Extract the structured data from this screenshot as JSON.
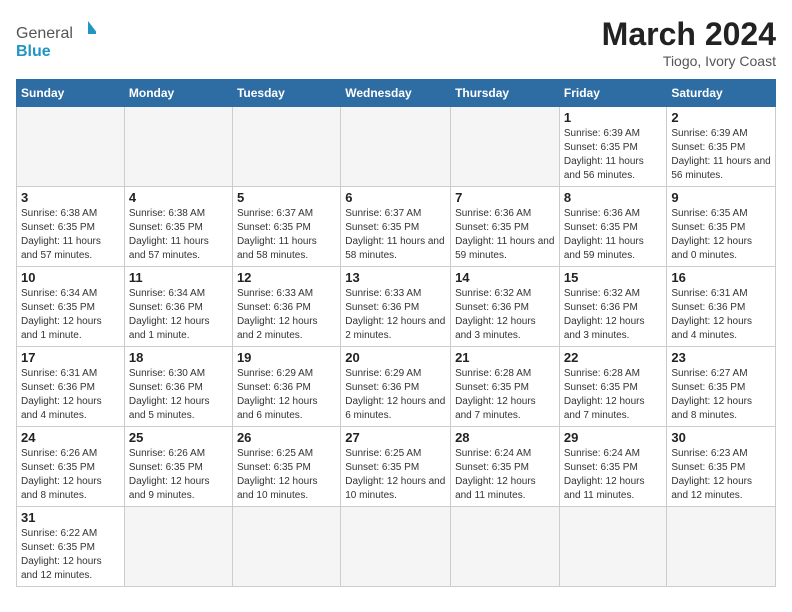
{
  "header": {
    "title": "March 2024",
    "subtitle": "Tiogo, Ivory Coast",
    "logo_general": "General",
    "logo_blue": "Blue"
  },
  "days_of_week": [
    "Sunday",
    "Monday",
    "Tuesday",
    "Wednesday",
    "Thursday",
    "Friday",
    "Saturday"
  ],
  "weeks": [
    [
      {
        "day": "",
        "info": ""
      },
      {
        "day": "",
        "info": ""
      },
      {
        "day": "",
        "info": ""
      },
      {
        "day": "",
        "info": ""
      },
      {
        "day": "",
        "info": ""
      },
      {
        "day": "1",
        "info": "Sunrise: 6:39 AM\nSunset: 6:35 PM\nDaylight: 11 hours and 56 minutes."
      },
      {
        "day": "2",
        "info": "Sunrise: 6:39 AM\nSunset: 6:35 PM\nDaylight: 11 hours and 56 minutes."
      }
    ],
    [
      {
        "day": "3",
        "info": "Sunrise: 6:38 AM\nSunset: 6:35 PM\nDaylight: 11 hours and 57 minutes."
      },
      {
        "day": "4",
        "info": "Sunrise: 6:38 AM\nSunset: 6:35 PM\nDaylight: 11 hours and 57 minutes."
      },
      {
        "day": "5",
        "info": "Sunrise: 6:37 AM\nSunset: 6:35 PM\nDaylight: 11 hours and 58 minutes."
      },
      {
        "day": "6",
        "info": "Sunrise: 6:37 AM\nSunset: 6:35 PM\nDaylight: 11 hours and 58 minutes."
      },
      {
        "day": "7",
        "info": "Sunrise: 6:36 AM\nSunset: 6:35 PM\nDaylight: 11 hours and 59 minutes."
      },
      {
        "day": "8",
        "info": "Sunrise: 6:36 AM\nSunset: 6:35 PM\nDaylight: 11 hours and 59 minutes."
      },
      {
        "day": "9",
        "info": "Sunrise: 6:35 AM\nSunset: 6:35 PM\nDaylight: 12 hours and 0 minutes."
      }
    ],
    [
      {
        "day": "10",
        "info": "Sunrise: 6:34 AM\nSunset: 6:35 PM\nDaylight: 12 hours and 1 minute."
      },
      {
        "day": "11",
        "info": "Sunrise: 6:34 AM\nSunset: 6:36 PM\nDaylight: 12 hours and 1 minute."
      },
      {
        "day": "12",
        "info": "Sunrise: 6:33 AM\nSunset: 6:36 PM\nDaylight: 12 hours and 2 minutes."
      },
      {
        "day": "13",
        "info": "Sunrise: 6:33 AM\nSunset: 6:36 PM\nDaylight: 12 hours and 2 minutes."
      },
      {
        "day": "14",
        "info": "Sunrise: 6:32 AM\nSunset: 6:36 PM\nDaylight: 12 hours and 3 minutes."
      },
      {
        "day": "15",
        "info": "Sunrise: 6:32 AM\nSunset: 6:36 PM\nDaylight: 12 hours and 3 minutes."
      },
      {
        "day": "16",
        "info": "Sunrise: 6:31 AM\nSunset: 6:36 PM\nDaylight: 12 hours and 4 minutes."
      }
    ],
    [
      {
        "day": "17",
        "info": "Sunrise: 6:31 AM\nSunset: 6:36 PM\nDaylight: 12 hours and 4 minutes."
      },
      {
        "day": "18",
        "info": "Sunrise: 6:30 AM\nSunset: 6:36 PM\nDaylight: 12 hours and 5 minutes."
      },
      {
        "day": "19",
        "info": "Sunrise: 6:29 AM\nSunset: 6:36 PM\nDaylight: 12 hours and 6 minutes."
      },
      {
        "day": "20",
        "info": "Sunrise: 6:29 AM\nSunset: 6:36 PM\nDaylight: 12 hours and 6 minutes."
      },
      {
        "day": "21",
        "info": "Sunrise: 6:28 AM\nSunset: 6:35 PM\nDaylight: 12 hours and 7 minutes."
      },
      {
        "day": "22",
        "info": "Sunrise: 6:28 AM\nSunset: 6:35 PM\nDaylight: 12 hours and 7 minutes."
      },
      {
        "day": "23",
        "info": "Sunrise: 6:27 AM\nSunset: 6:35 PM\nDaylight: 12 hours and 8 minutes."
      }
    ],
    [
      {
        "day": "24",
        "info": "Sunrise: 6:26 AM\nSunset: 6:35 PM\nDaylight: 12 hours and 8 minutes."
      },
      {
        "day": "25",
        "info": "Sunrise: 6:26 AM\nSunset: 6:35 PM\nDaylight: 12 hours and 9 minutes."
      },
      {
        "day": "26",
        "info": "Sunrise: 6:25 AM\nSunset: 6:35 PM\nDaylight: 12 hours and 10 minutes."
      },
      {
        "day": "27",
        "info": "Sunrise: 6:25 AM\nSunset: 6:35 PM\nDaylight: 12 hours and 10 minutes."
      },
      {
        "day": "28",
        "info": "Sunrise: 6:24 AM\nSunset: 6:35 PM\nDaylight: 12 hours and 11 minutes."
      },
      {
        "day": "29",
        "info": "Sunrise: 6:24 AM\nSunset: 6:35 PM\nDaylight: 12 hours and 11 minutes."
      },
      {
        "day": "30",
        "info": "Sunrise: 6:23 AM\nSunset: 6:35 PM\nDaylight: 12 hours and 12 minutes."
      }
    ],
    [
      {
        "day": "31",
        "info": "Sunrise: 6:22 AM\nSunset: 6:35 PM\nDaylight: 12 hours and 12 minutes."
      },
      {
        "day": "",
        "info": ""
      },
      {
        "day": "",
        "info": ""
      },
      {
        "day": "",
        "info": ""
      },
      {
        "day": "",
        "info": ""
      },
      {
        "day": "",
        "info": ""
      },
      {
        "day": "",
        "info": ""
      }
    ]
  ]
}
